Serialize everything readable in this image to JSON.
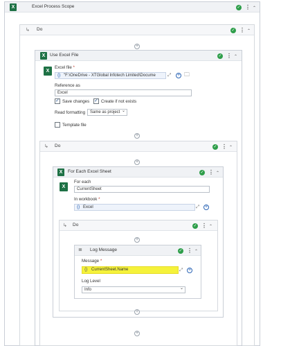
{
  "scope": {
    "title": "Excel Process Scope"
  },
  "do_outer": {
    "title": "Do"
  },
  "use_excel": {
    "title": "Use Excel File",
    "file_label": "Excel file",
    "file_value": "\"F:\\OneDrive - XTGlobal Infotech Limited\\Docume",
    "ref_label": "Reference as",
    "ref_value": "Excel",
    "save_changes": "Save changes",
    "create_if_not": "Create if not exists",
    "read_formatting_label": "Read formatting",
    "read_formatting_value": "Same as project",
    "template_file": "Template file"
  },
  "do_mid": {
    "title": "Do"
  },
  "for_each": {
    "title": "For Each Excel Sheet",
    "for_each_label": "For each",
    "for_each_value": "CurrentSheet",
    "in_workbook_label": "In workbook",
    "in_workbook_value": "Excel"
  },
  "do_inner": {
    "title": "Do"
  },
  "log_message": {
    "title": "Log Message",
    "message_label": "Message",
    "message_value": "CurrentSheet.Name",
    "level_label": "Log Level",
    "level_value": "Info"
  },
  "glyphs": {
    "check": "✓",
    "dots": "⋮",
    "collapse": "⌃",
    "plus": "+",
    "arrow": "↳",
    "expr": "{}",
    "chevron": "⌄",
    "excel": "X",
    "star": "*"
  },
  "colors": {
    "highlight": "#f5f23a",
    "status_ok": "#2e9e4a",
    "excel_green": "#1e7145"
  }
}
